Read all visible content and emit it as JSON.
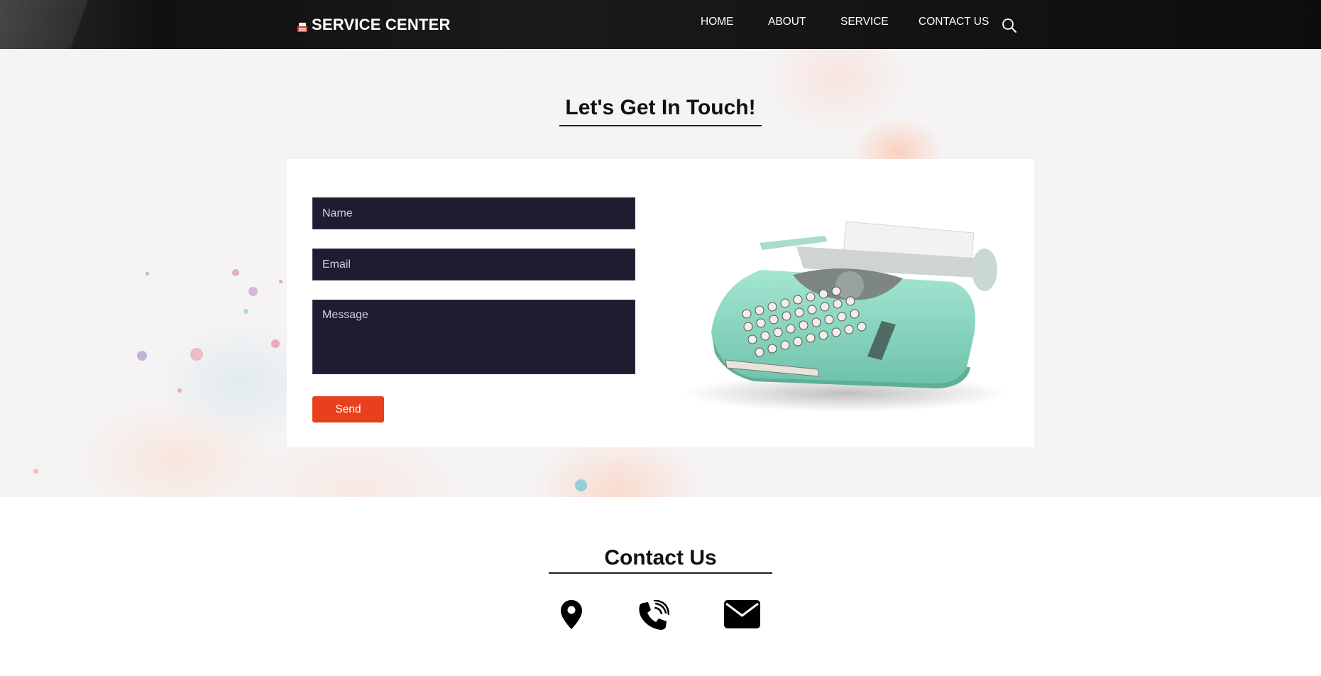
{
  "header": {
    "brand": "SERVICE CENTER",
    "nav": [
      "HOME",
      "ABOUT",
      "SERVICE",
      "CONTACT US"
    ],
    "search_icon": "search-icon"
  },
  "hero": {
    "title": "Let's Get In Touch!"
  },
  "form": {
    "name_placeholder": "Name",
    "email_placeholder": "Email",
    "message_placeholder": "Message",
    "send_label": "Send"
  },
  "contact": {
    "title": "Contact Us",
    "icons": [
      "location-pin-icon",
      "phone-icon",
      "envelope-icon"
    ]
  },
  "colors": {
    "header_bg": "#111111",
    "field_bg": "#1e1c30",
    "send_button": "#e8401c",
    "typewriter": "#8fdcc4"
  }
}
